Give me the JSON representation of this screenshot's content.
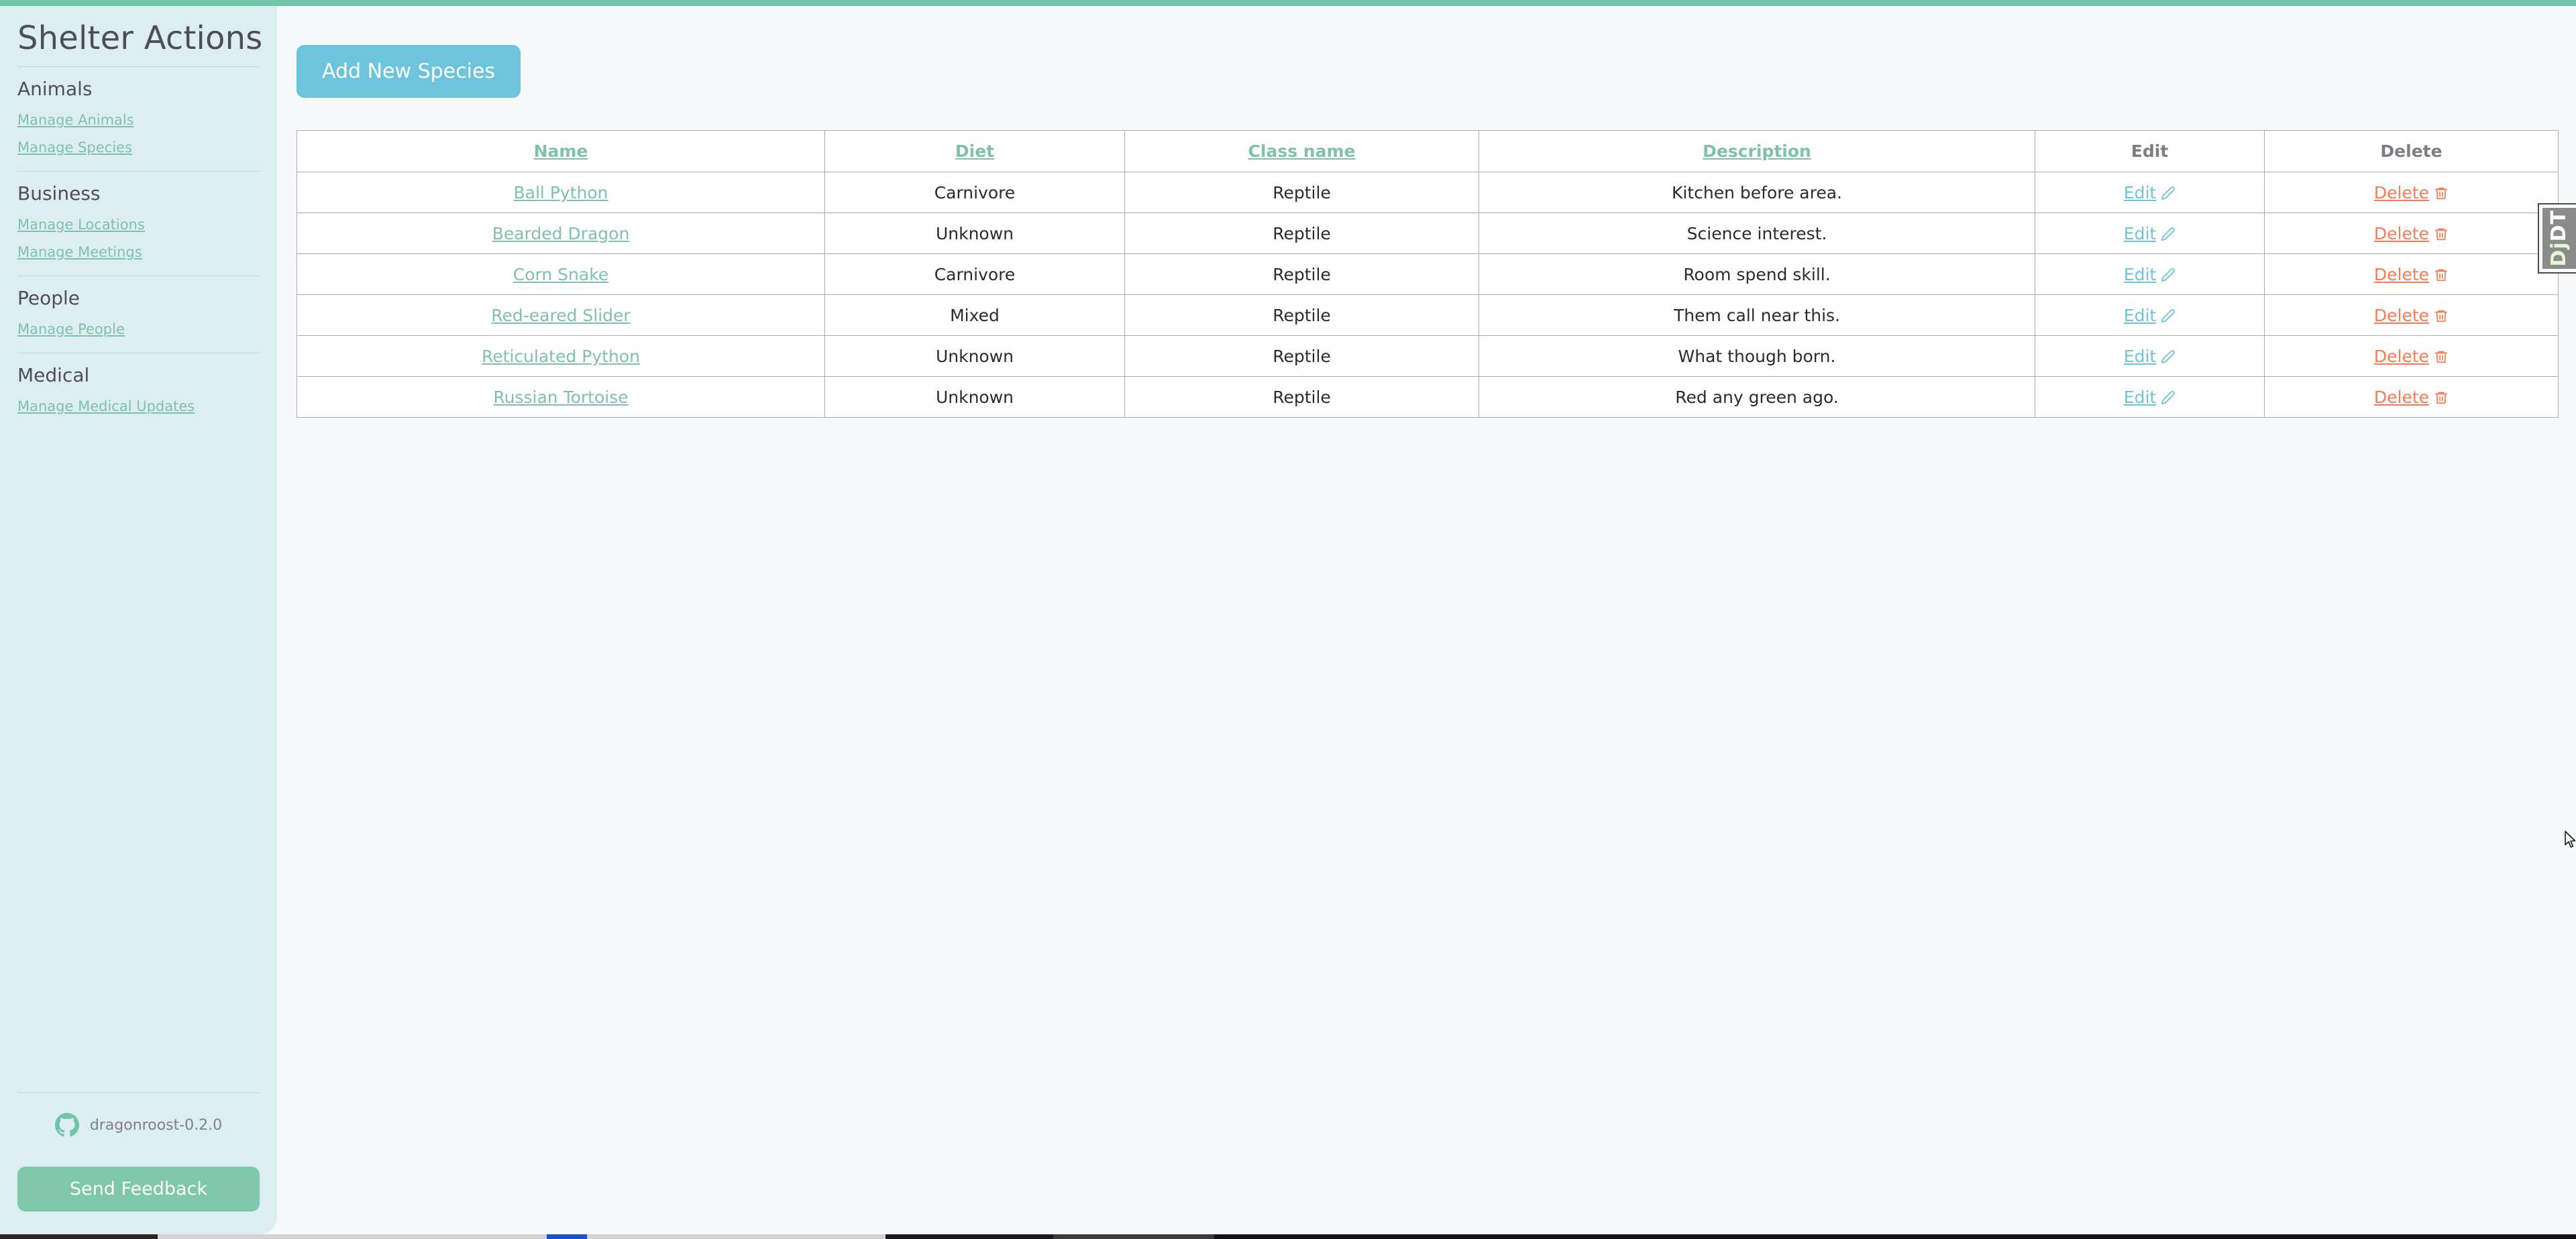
{
  "sidebar": {
    "brand": "Shelter Actions",
    "groups": [
      {
        "title": "Animals",
        "links": [
          "Manage Animals",
          "Manage Species"
        ]
      },
      {
        "title": "Business",
        "links": [
          "Manage Locations",
          "Manage Meetings"
        ]
      },
      {
        "title": "People",
        "links": [
          "Manage People"
        ]
      },
      {
        "title": "Medical",
        "links": [
          "Manage Medical Updates"
        ]
      }
    ],
    "footer": {
      "github_icon": "github-icon",
      "version": "dragonroost-0.2.0",
      "feedback_label": "Send Feedback"
    }
  },
  "main": {
    "add_button": "Add New Species",
    "table": {
      "headers": [
        {
          "label": "Name",
          "sortable": true
        },
        {
          "label": "Diet",
          "sortable": true
        },
        {
          "label": "Class name",
          "sortable": true
        },
        {
          "label": "Description",
          "sortable": true
        },
        {
          "label": "Edit",
          "sortable": false
        },
        {
          "label": "Delete",
          "sortable": false
        }
      ],
      "edit_label": "Edit",
      "delete_label": "Delete",
      "edit_icon": "pencil-icon",
      "delete_icon": "trash-icon",
      "rows": [
        {
          "name": "Ball Python",
          "diet": "Carnivore",
          "class_name": "Reptile",
          "description": "Kitchen before area."
        },
        {
          "name": "Bearded Dragon",
          "diet": "Unknown",
          "class_name": "Reptile",
          "description": "Science interest."
        },
        {
          "name": "Corn Snake",
          "diet": "Carnivore",
          "class_name": "Reptile",
          "description": "Room spend skill."
        },
        {
          "name": "Red-eared Slider",
          "diet": "Mixed",
          "class_name": "Reptile",
          "description": "Them call near this."
        },
        {
          "name": "Reticulated Python",
          "diet": "Unknown",
          "class_name": "Reptile",
          "description": "What though born."
        },
        {
          "name": "Russian Tortoise",
          "diet": "Unknown",
          "class_name": "Reptile",
          "description": "Red any green ago."
        }
      ]
    }
  },
  "debug_toolbar": {
    "handle_prefix": "Dj",
    "handle_suffix": "DT"
  },
  "colors": {
    "accent_green": "#6ec5a8",
    "sidebar_bg": "#ddeef3",
    "link_green": "#7fc2a9",
    "add_blue": "#6cc5dc",
    "edit_blue": "#6cc5dc",
    "delete_orange": "#fa7a55",
    "feedback_green": "#7fc8ac",
    "page_bg": "#f7f9fa"
  }
}
